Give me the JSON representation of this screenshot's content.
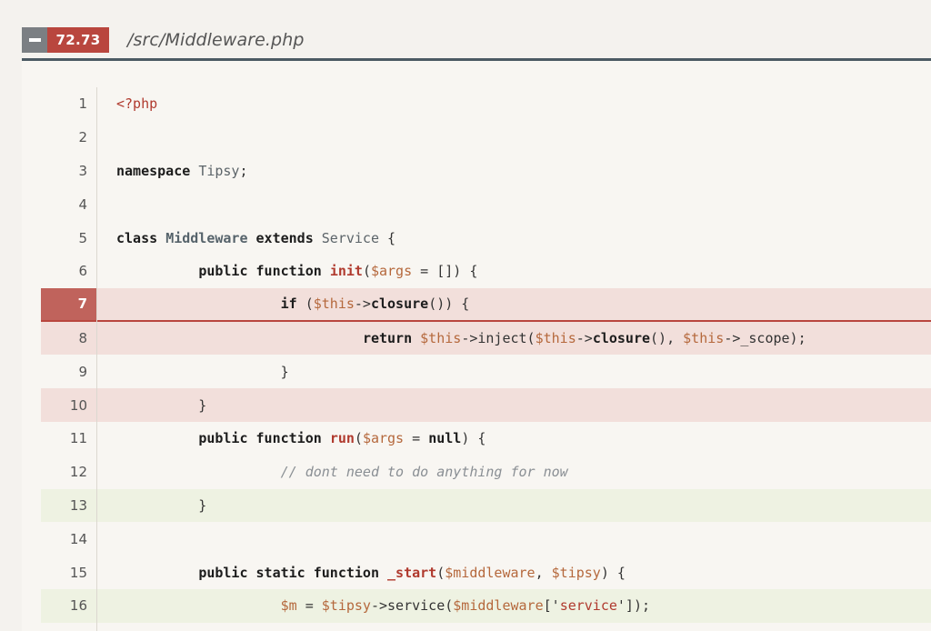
{
  "header": {
    "score": "72.73",
    "file_path": "/src/Middleware.php"
  },
  "colors": {
    "missed_bg": "#f2dfdb",
    "covered_bg": "#eef2e2",
    "score_badge": "#b9463e",
    "rule": "#4b5a63"
  },
  "lines": [
    {
      "num": "1",
      "status": "none",
      "tokens": [
        [
          "tag",
          "<?php"
        ]
      ]
    },
    {
      "num": "2",
      "status": "none",
      "tokens": []
    },
    {
      "num": "3",
      "status": "none",
      "tokens": [
        [
          "kw",
          "namespace"
        ],
        [
          "plain",
          " "
        ],
        [
          "ns",
          "Tipsy"
        ],
        [
          "plain",
          ";"
        ]
      ]
    },
    {
      "num": "4",
      "status": "none",
      "tokens": []
    },
    {
      "num": "5",
      "status": "none",
      "tokens": [
        [
          "kw",
          "class"
        ],
        [
          "plain",
          " "
        ],
        [
          "cls",
          "Middleware"
        ],
        [
          "plain",
          " "
        ],
        [
          "kw",
          "extends"
        ],
        [
          "plain",
          " "
        ],
        [
          "ns",
          "Service"
        ],
        [
          "plain",
          " {"
        ]
      ]
    },
    {
      "num": "6",
      "status": "none",
      "tokens": [
        [
          "plain",
          "          "
        ],
        [
          "kw",
          "public"
        ],
        [
          "plain",
          " "
        ],
        [
          "kw",
          "function"
        ],
        [
          "plain",
          " "
        ],
        [
          "fn",
          "init"
        ],
        [
          "plain",
          "("
        ],
        [
          "var",
          "$args"
        ],
        [
          "plain",
          " = []) {"
        ]
      ]
    },
    {
      "num": "7",
      "status": "active",
      "tokens": [
        [
          "plain",
          "                    "
        ],
        [
          "kw",
          "if"
        ],
        [
          "plain",
          " ("
        ],
        [
          "var",
          "$this"
        ],
        [
          "plain",
          "->"
        ],
        [
          "kw",
          "closure"
        ],
        [
          "plain",
          "()) {"
        ]
      ]
    },
    {
      "num": "8",
      "status": "missed",
      "tokens": [
        [
          "plain",
          "                              "
        ],
        [
          "kw",
          "return"
        ],
        [
          "plain",
          " "
        ],
        [
          "var",
          "$this"
        ],
        [
          "plain",
          "->inject("
        ],
        [
          "var",
          "$this"
        ],
        [
          "plain",
          "->"
        ],
        [
          "kw",
          "closure"
        ],
        [
          "plain",
          "(), "
        ],
        [
          "var",
          "$this"
        ],
        [
          "plain",
          "->_scope);"
        ]
      ]
    },
    {
      "num": "9",
      "status": "none",
      "tokens": [
        [
          "plain",
          "                    }"
        ]
      ]
    },
    {
      "num": "10",
      "status": "missed",
      "tokens": [
        [
          "plain",
          "          }"
        ]
      ]
    },
    {
      "num": "11",
      "status": "none",
      "tokens": [
        [
          "plain",
          "          "
        ],
        [
          "kw",
          "public"
        ],
        [
          "plain",
          " "
        ],
        [
          "kw",
          "function"
        ],
        [
          "plain",
          " "
        ],
        [
          "fn",
          "run"
        ],
        [
          "plain",
          "("
        ],
        [
          "var",
          "$args"
        ],
        [
          "plain",
          " = "
        ],
        [
          "kw",
          "null"
        ],
        [
          "plain",
          ") {"
        ]
      ]
    },
    {
      "num": "12",
      "status": "none",
      "tokens": [
        [
          "plain",
          "                    "
        ],
        [
          "cmt",
          "// dont need to do anything for now"
        ]
      ]
    },
    {
      "num": "13",
      "status": "covered",
      "tokens": [
        [
          "plain",
          "          }"
        ]
      ]
    },
    {
      "num": "14",
      "status": "none",
      "tokens": []
    },
    {
      "num": "15",
      "status": "none",
      "tokens": [
        [
          "plain",
          "          "
        ],
        [
          "kw",
          "public"
        ],
        [
          "plain",
          " "
        ],
        [
          "kw",
          "static"
        ],
        [
          "plain",
          " "
        ],
        [
          "kw",
          "function"
        ],
        [
          "plain",
          " "
        ],
        [
          "fn",
          "_start"
        ],
        [
          "plain",
          "("
        ],
        [
          "var",
          "$middleware"
        ],
        [
          "plain",
          ", "
        ],
        [
          "var",
          "$tipsy"
        ],
        [
          "plain",
          ") {"
        ]
      ]
    },
    {
      "num": "16",
      "status": "covered",
      "tokens": [
        [
          "plain",
          "                    "
        ],
        [
          "var",
          "$m"
        ],
        [
          "plain",
          " = "
        ],
        [
          "var",
          "$tipsy"
        ],
        [
          "plain",
          "->service("
        ],
        [
          "var",
          "$middleware"
        ],
        [
          "plain",
          "['"
        ],
        [
          "str",
          "service"
        ],
        [
          "plain",
          "']);"
        ]
      ]
    }
  ]
}
